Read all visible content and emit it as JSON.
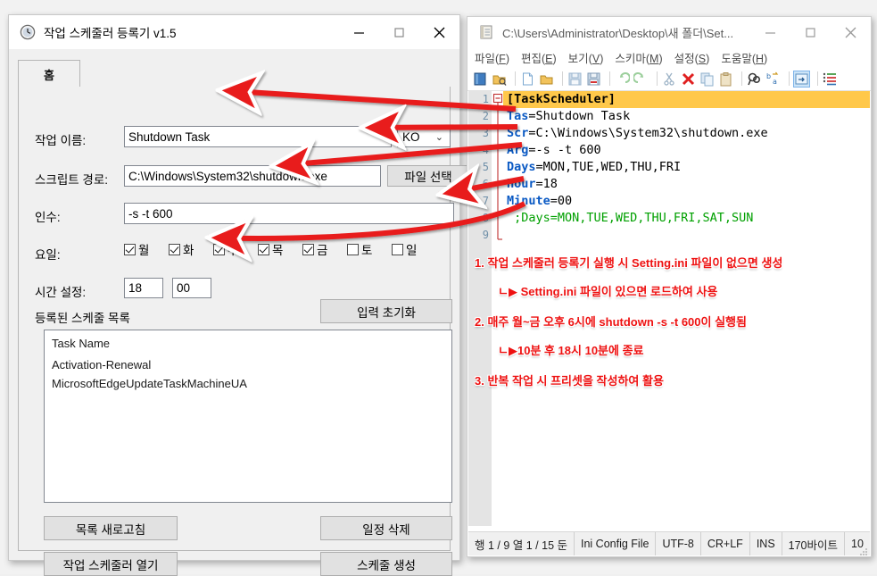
{
  "app": {
    "title": "작업 스케줄러 등록기 v1.5",
    "title_icon": "clock-icon",
    "tab_home": "홈",
    "minimize": "–",
    "maximize": "□",
    "close": "✕",
    "fields": {
      "name_label": "작업 이름:",
      "name_value": "Shutdown Task",
      "lang_value": "KO",
      "path_label": "스크립트 경로:",
      "path_value": "C:\\Windows\\System32\\shutdown.exe",
      "browse_button": "파일 선택",
      "args_label": "인수:",
      "args_value": "-s -t 600",
      "days_label": "요일:",
      "time_label": "시간 설정:",
      "hour_value": "18",
      "minute_value": "00"
    },
    "days": [
      {
        "label": "월",
        "checked": true
      },
      {
        "label": "화",
        "checked": true
      },
      {
        "label": "수",
        "checked": true
      },
      {
        "label": "목",
        "checked": true
      },
      {
        "label": "금",
        "checked": true
      },
      {
        "label": "토",
        "checked": false
      },
      {
        "label": "일",
        "checked": false
      }
    ],
    "reset_button": "입력 초기화",
    "list_title": "등록된 스케줄 목록",
    "list_items": [
      "Task Name",
      "Activation-Renewal",
      "MicrosoftEdgeUpdateTaskMachineUA"
    ],
    "buttons": {
      "refresh": "목록 새로고침",
      "delete": "일정 삭제",
      "open_scheduler": "작업 스케줄러 열기",
      "create": "스케줄 생성"
    }
  },
  "editor": {
    "title": "C:\\Users\\Administrator\\Desktop\\새 폴더\\Set...",
    "title_icon": "notepad-icon",
    "minimize": "–",
    "maximize": "□",
    "close": "✕",
    "menu": [
      {
        "text": "파일(F)",
        "key": "F"
      },
      {
        "text": "편집(E)",
        "key": "E"
      },
      {
        "text": "보기(V)",
        "key": "V"
      },
      {
        "text": "스키마(M)",
        "key": "M"
      },
      {
        "text": "설정(S)",
        "key": "S"
      },
      {
        "text": "도움말(H)",
        "key": "H"
      }
    ],
    "toolbar_icons": [
      "book-icon",
      "open-folder-search-icon",
      "new-file-icon",
      "open-file-icon",
      "save-icon",
      "save-all-icon",
      "undo-icon",
      "redo-icon",
      "cut-icon",
      "delete-icon",
      "copy-icon",
      "paste-icon",
      "find-icon",
      "replace-icon",
      "word-wrap-icon",
      "list-icon"
    ],
    "lines": [
      {
        "n": "1",
        "kind": "section",
        "text": "[TaskScheduler]",
        "highlight": true
      },
      {
        "n": "2",
        "kind": "pair",
        "key": "Tas",
        "value": "Shutdown Task"
      },
      {
        "n": "3",
        "kind": "pair",
        "key": "Scr",
        "value": "C:\\Windows\\System32\\shutdown.exe"
      },
      {
        "n": "4",
        "kind": "pair",
        "key": "Arg",
        "value": "-s -t 600"
      },
      {
        "n": "5",
        "kind": "pair",
        "key": "Days",
        "value": "MON,TUE,WED,THU,FRI"
      },
      {
        "n": "6",
        "kind": "pair",
        "key": "Hour",
        "value": "18"
      },
      {
        "n": "7",
        "kind": "pair",
        "key": "Minute",
        "value": "00"
      },
      {
        "n": "8",
        "kind": "comment",
        "text": ";Days=MON,TUE,WED,THU,FRI,SAT,SUN"
      },
      {
        "n": "9",
        "kind": "empty",
        "text": ""
      }
    ],
    "annotations": [
      "1. 작업 스케줄러 등록기 실행 시 Setting.ini 파일이 없으면 생성",
      "ㄴ▶ Setting.ini 파일이 있으면 로드하여 사용",
      "2. 매주 월~금 오후 6시에 shutdown -s -t 600이 실행됨",
      "ㄴ▶10분 후 18시 10분에 종료",
      "3. 반복 작업 시 프리셋을 작성하여 활용"
    ],
    "status": [
      "행 1 / 9   열 1 / 15   둔",
      "Ini Config File",
      "UTF-8",
      "CR+LF",
      "INS",
      "170바이트",
      "10"
    ]
  },
  "colors": {
    "accent_red": "#ee1111",
    "highlight_line": "#ffc84a",
    "key_blue": "#0b5ac4",
    "comment_green": "#00a000",
    "button_face": "#e1e1e1"
  }
}
